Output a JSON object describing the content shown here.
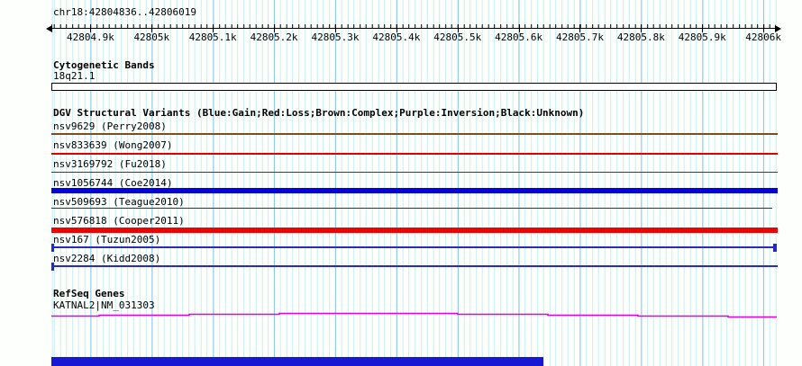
{
  "ruler": {
    "region_label": "chr18:42804836..42806019",
    "start": 42804836,
    "end": 42806019,
    "tick_labels": [
      "42804.9k",
      "42805k",
      "42805.1k",
      "42805.2k",
      "42805.3k",
      "42805.4k",
      "42805.5k",
      "42805.6k",
      "42805.7k",
      "42805.8k",
      "42805.9k",
      "42806k"
    ]
  },
  "cytobands": {
    "title": "Cytogenetic Bands",
    "band_label": "18q21.1"
  },
  "dgv": {
    "title": "DGV Structural Variants (Blue:Gain;Red:Loss;Brown:Complex;Purple:Inversion;Black:Unknown)",
    "variants": [
      {
        "label": "nsv9629 (Perry2008)",
        "type": "complex",
        "color": "#7b4e1e"
      },
      {
        "label": "nsv833639 (Wong2007)",
        "type": "loss",
        "color": "#e00000"
      },
      {
        "label": "nsv3169792 (Fu2018)",
        "type": "loss",
        "color": "#c80000"
      },
      {
        "label": "nsv1056744 (Coe2014)",
        "type": "gain",
        "color": "#0404d8"
      },
      {
        "label": "nsv509693 (Teague2010)",
        "type": "gain",
        "color": "#2222b4"
      },
      {
        "label": "nsv576818 (Cooper2011)",
        "type": "loss",
        "color": "#ea0404"
      },
      {
        "label": "nsv167 (Tuzun2005)",
        "type": "gain",
        "color": "#2a2ac0"
      },
      {
        "label": "nsv2284 (Kidd2008)",
        "type": "gain",
        "color": "#2a2ac0"
      }
    ]
  },
  "refseq": {
    "title": "RefSeq Genes",
    "gene_label": "KATNAL2|NM_031303",
    "gene_color": "#e400e4"
  },
  "colors": {
    "grid_minor": "#c9edf3",
    "grid_major": "#8cc6e4",
    "bottom_bar": "#1717d4"
  }
}
